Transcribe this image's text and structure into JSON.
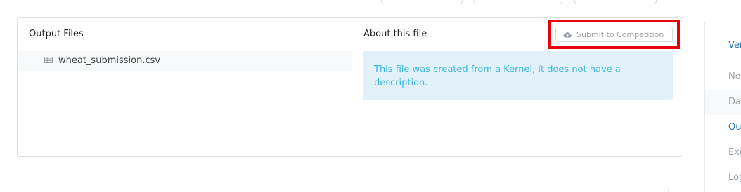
{
  "output_files": {
    "title": "Output Files",
    "files": [
      {
        "name": "wheat_submission.csv",
        "icon": "table-icon"
      }
    ]
  },
  "about": {
    "title": "About this file",
    "submit_label": "Submit to Competition",
    "submit_icon": "cloud-upload-icon",
    "description": "This file was created from a Kernel, it does not have a description."
  },
  "sidebar": {
    "items": [
      {
        "label": "Version"
      },
      {
        "label": "Notebook"
      },
      {
        "label": "Data"
      },
      {
        "label": "Output"
      },
      {
        "label": "Execution Info"
      },
      {
        "label": "Log"
      }
    ]
  },
  "colors": {
    "accent": "#1a73b8",
    "highlight": "#e8000b",
    "desc_bg": "#e2f0f7",
    "desc_text": "#39b7e0"
  }
}
